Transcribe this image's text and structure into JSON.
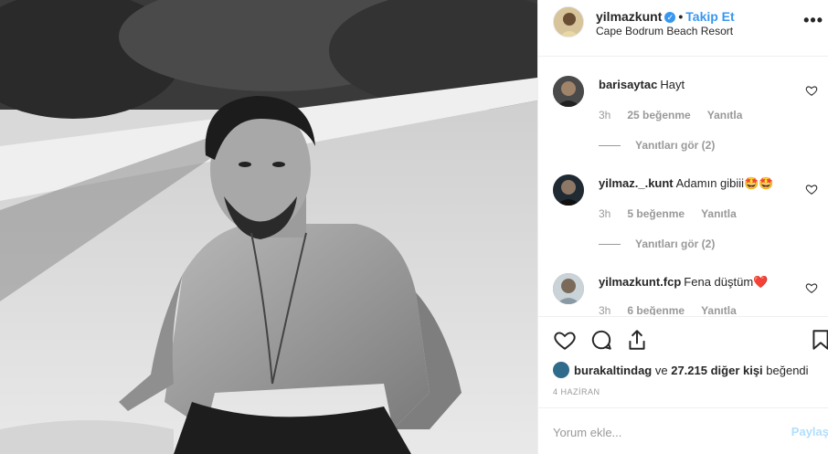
{
  "post": {
    "username": "yilmazkunt",
    "follow_label": "Takip Et",
    "location": "Cape Bodrum Beach Resort",
    "more_label": "•••"
  },
  "comments": [
    {
      "username": "barisaytac",
      "text": "Hayt",
      "time": "3h",
      "likes": "25 beğenme",
      "reply": "Yanıtla",
      "view_replies": "Yanıtları gör (2)"
    },
    {
      "username": "yilmaz._.kunt",
      "text": "Adamın gibiii🤩🤩",
      "time": "3h",
      "likes": "5 beğenme",
      "reply": "Yanıtla",
      "view_replies": "Yanıtları gör (2)"
    },
    {
      "username": "yilmazkunt.fcp",
      "text": "Fena düştüm❤️",
      "time": "3h",
      "likes": "6 beğenme",
      "reply": "Yanıtla"
    }
  ],
  "likes_line": {
    "liker": "burakaltindag",
    "middle": " ve ",
    "count": "27.215 diğer kişi",
    "suffix": " beğendi"
  },
  "date": "4 HAZİRAN",
  "add_comment": {
    "placeholder": "Yorum ekle...",
    "post_label": "Paylaş"
  },
  "icons": {
    "like": "heart-icon",
    "comment": "comment-icon",
    "share": "share-icon",
    "save": "bookmark-icon",
    "verified": "verified-badge-icon"
  },
  "colors": {
    "accent": "#3897f0",
    "muted": "#999999",
    "post_disabled": "#b2dffc"
  }
}
